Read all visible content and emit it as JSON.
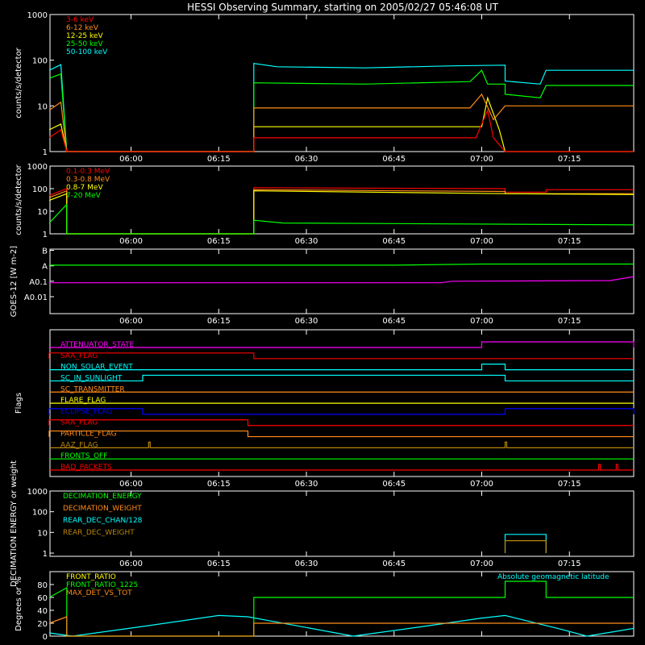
{
  "title": "HESSI Observing Summary, starting on 2005/02/27 05:46:08 UT",
  "time_ticks": [
    "06:00",
    "06:15",
    "06:30",
    "06:45",
    "07:00",
    "07:15"
  ],
  "colors": {
    "red": "#ff0000",
    "orange": "#ff8c1a",
    "yellow": "#ffff00",
    "green": "#00ff00",
    "cyan": "#00ffff",
    "blue": "#0000ff",
    "magenta": "#ff00ff",
    "brown": "#b8860b",
    "white": "#ffffff",
    "axis": "#ffffff"
  },
  "chart_data": [
    {
      "id": "panel1",
      "type": "line",
      "yscale": "log",
      "ylabel": "counts/s/detector",
      "ylim": [
        1,
        1000
      ],
      "yticks": [
        1,
        10,
        100,
        1000
      ],
      "ytick_labels": [
        "1",
        "10",
        "100",
        "1000"
      ],
      "time_window": [
        "05:46:08",
        "07:26:00"
      ],
      "legend": [
        "3-6 keV",
        "6-12 keV",
        "12-25 keV",
        "25-50 keV",
        "50-100 keV"
      ],
      "series": [
        {
          "name": "50-100 keV",
          "color": "cyan",
          "points": [
            [
              "05:46",
              "60"
            ],
            [
              "05:48",
              "80"
            ],
            [
              "05:49",
              "1"
            ],
            [
              "06:21",
              "1"
            ],
            [
              "06:21",
              "85"
            ],
            [
              "06:25",
              "72"
            ],
            [
              "06:40",
              "68"
            ],
            [
              "06:55",
              "75"
            ],
            [
              "07:04",
              "78"
            ],
            [
              "07:04",
              "35"
            ],
            [
              "07:10",
              "30"
            ],
            [
              "07:11",
              "60"
            ],
            [
              "07:26",
              "60"
            ]
          ]
        },
        {
          "name": "25-50 keV",
          "color": "green",
          "points": [
            [
              "05:46",
              "40"
            ],
            [
              "05:48",
              "50"
            ],
            [
              "05:49",
              "1"
            ],
            [
              "06:21",
              "1"
            ],
            [
              "06:21",
              "32"
            ],
            [
              "06:40",
              "30"
            ],
            [
              "06:58",
              "34"
            ],
            [
              "07:00",
              "60"
            ],
            [
              "07:01",
              "30"
            ],
            [
              "07:04",
              "30"
            ],
            [
              "07:04",
              "18"
            ],
            [
              "07:10",
              "15"
            ],
            [
              "07:11",
              "28"
            ],
            [
              "07:26",
              "28"
            ]
          ]
        },
        {
          "name": "12-25 keV",
          "color": "yellow",
          "points": [
            [
              "05:46",
              "3"
            ],
            [
              "05:48",
              "4"
            ],
            [
              "05:49",
              "1"
            ],
            [
              "06:21",
              "1"
            ],
            [
              "06:21",
              "3.5"
            ],
            [
              "07:00",
              "3.5"
            ],
            [
              "07:01",
              "15"
            ],
            [
              "07:03",
              "3"
            ],
            [
              "07:04",
              "1"
            ],
            [
              "07:26",
              "1"
            ]
          ]
        },
        {
          "name": "6-12 keV",
          "color": "orange",
          "points": [
            [
              "05:46",
              "8"
            ],
            [
              "05:48",
              "12"
            ],
            [
              "05:49",
              "1"
            ],
            [
              "06:21",
              "1"
            ],
            [
              "06:21",
              "9"
            ],
            [
              "06:58",
              "9"
            ],
            [
              "07:00",
              "18"
            ],
            [
              "07:02",
              "5"
            ],
            [
              "07:04",
              "10"
            ],
            [
              "07:26",
              "10"
            ]
          ]
        },
        {
          "name": "3-6 keV",
          "color": "red",
          "points": [
            [
              "05:46",
              "2"
            ],
            [
              "05:48",
              "3"
            ],
            [
              "05:49",
              "1"
            ],
            [
              "06:21",
              "1"
            ],
            [
              "06:21",
              "2"
            ],
            [
              "06:59",
              "2"
            ],
            [
              "07:01",
              "8"
            ],
            [
              "07:02",
              "2"
            ],
            [
              "07:04",
              "1"
            ],
            [
              "07:26",
              "1"
            ]
          ]
        }
      ]
    },
    {
      "id": "panel2",
      "type": "line",
      "yscale": "log",
      "ylabel": "counts/s/detector",
      "ylim": [
        1,
        1000
      ],
      "yticks": [
        1,
        10,
        100,
        1000
      ],
      "ytick_labels": [
        "1",
        "10",
        "100",
        "1000"
      ],
      "time_window": [
        "05:46:08",
        "07:26:00"
      ],
      "legend": [
        "0.1-0.3 MeV",
        "0.3-0.8 MeV",
        "0.8-7 MeV",
        "7-20 MeV"
      ],
      "series": [
        {
          "name": "0.1-0.3 MeV",
          "color": "red",
          "points": [
            [
              "05:46",
              "50"
            ],
            [
              "05:49",
              "100"
            ],
            [
              "05:49",
              "1"
            ],
            [
              "06:21",
              "1"
            ],
            [
              "06:21",
              "110"
            ],
            [
              "07:04",
              "100"
            ],
            [
              "07:04",
              "70"
            ],
            [
              "07:11",
              "70"
            ],
            [
              "07:11",
              "90"
            ],
            [
              "07:26",
              "90"
            ]
          ]
        },
        {
          "name": "0.3-0.8 MeV",
          "color": "orange",
          "points": [
            [
              "05:46",
              "40"
            ],
            [
              "05:49",
              "80"
            ],
            [
              "05:49",
              "1"
            ],
            [
              "06:21",
              "1"
            ],
            [
              "06:21",
              "90"
            ],
            [
              "07:04",
              "75"
            ],
            [
              "07:04",
              "60"
            ],
            [
              "07:26",
              "60"
            ]
          ]
        },
        {
          "name": "0.8-7 MeV",
          "color": "yellow",
          "points": [
            [
              "05:46",
              "30"
            ],
            [
              "05:49",
              "60"
            ],
            [
              "05:49",
              "1"
            ],
            [
              "06:21",
              "1"
            ],
            [
              "06:21",
              "80"
            ],
            [
              "07:04",
              "60"
            ],
            [
              "07:26",
              "55"
            ]
          ]
        },
        {
          "name": "7-20 MeV",
          "color": "green",
          "points": [
            [
              "05:46",
              "3"
            ],
            [
              "05:49",
              "20"
            ],
            [
              "05:49",
              "1"
            ],
            [
              "06:21",
              "1"
            ],
            [
              "06:21",
              "4"
            ],
            [
              "06:26",
              "3"
            ],
            [
              "07:26",
              "2.5"
            ]
          ]
        }
      ]
    },
    {
      "id": "panel3",
      "type": "line",
      "yscale": "log",
      "ylabel": "GOES-12 [W m-2]",
      "ylim": [
        0.0008,
        12
      ],
      "yticks": [
        0.01,
        0.1,
        1,
        10
      ],
      "ytick_labels": [
        "A0.01",
        "A0.1",
        "A",
        "B"
      ],
      "time_window": [
        "05:46:08",
        "07:26:00"
      ],
      "series": [
        {
          "name": "",
          "color": "green",
          "points": [
            [
              "05:46",
              "1.1"
            ],
            [
              "06:45",
              "1.1"
            ],
            [
              "07:00",
              "1.3"
            ],
            [
              "07:26",
              "1.3"
            ]
          ]
        },
        {
          "name": "",
          "color": "magenta",
          "points": [
            [
              "05:46",
              "0.08"
            ],
            [
              "06:53",
              "0.08"
            ],
            [
              "06:55",
              "0.1"
            ],
            [
              "07:22",
              "0.11"
            ],
            [
              "07:26",
              "0.2"
            ]
          ]
        }
      ]
    },
    {
      "id": "flags",
      "type": "flags",
      "ylabel": "Flags",
      "time_window": [
        "05:46:08",
        "07:26:00"
      ],
      "rows": [
        {
          "name": "ATTENUATOR_STATE",
          "color": "magenta",
          "on": [
            [
              "07:00",
              "07:26"
            ]
          ]
        },
        {
          "name": "SAA_FLAG",
          "color": "red",
          "on": [
            [
              "05:46",
              "06:21"
            ]
          ]
        },
        {
          "name": "NON_SOLAR_EVENT",
          "color": "cyan",
          "on": [
            [
              "07:00",
              "07:04"
            ]
          ]
        },
        {
          "name": "SC_IN_SUNLIGHT",
          "color": "cyan",
          "on": [
            [
              "06:02",
              "07:04"
            ]
          ]
        },
        {
          "name": "SC_TRANSMITTER",
          "color": "orange",
          "on": []
        },
        {
          "name": "FLARE_FLAG",
          "color": "yellow",
          "on": []
        },
        {
          "name": "ECLIPSE_FLAG",
          "color": "blue",
          "on": [
            [
              "05:46",
              "06:02"
            ],
            [
              "07:04",
              "07:26"
            ]
          ]
        },
        {
          "name": "SAA_FLAG",
          "color": "red",
          "on": [
            [
              "05:46",
              "06:20"
            ]
          ]
        },
        {
          "name": "PARTICLE_FLAG",
          "color": "orange",
          "on": [
            [
              "05:46",
              "06:20"
            ]
          ]
        },
        {
          "name": "AAZ_FLAG",
          "color": "brown",
          "on": [
            [
              "06:03",
              "06:03"
            ],
            [
              "07:04",
              "07:04"
            ]
          ]
        },
        {
          "name": "FRONTS_OFF",
          "color": "green",
          "on": []
        },
        {
          "name": "BAD_PACKETS",
          "color": "red",
          "on": [
            [
              "07:20",
              "07:20"
            ],
            [
              "07:23",
              "07:23"
            ]
          ]
        }
      ]
    },
    {
      "id": "decimation",
      "type": "line",
      "yscale": "log",
      "ylabel": "DECIMATION ENERGY or weight",
      "ylim": [
        0.7,
        1000
      ],
      "yticks": [
        1,
        10,
        100,
        1000
      ],
      "ytick_labels": [
        "1",
        "10",
        "100",
        "1000"
      ],
      "time_window": [
        "05:46:08",
        "07:26:00"
      ],
      "legend": [
        "DECIMATION_ENERGY",
        "DECIMATION_WEIGHT",
        "REAR_DEC_CHAN/128",
        "REAR_DEC_WEIGHT"
      ],
      "series": [
        {
          "name": "REAR_DEC_CHAN/128",
          "color": "cyan",
          "points": [
            [
              "07:04",
              "1"
            ],
            [
              "07:04",
              "8"
            ],
            [
              "07:11",
              "8"
            ],
            [
              "07:11",
              "1"
            ]
          ]
        },
        {
          "name": "REAR_DEC_WEIGHT",
          "color": "brown",
          "points": [
            [
              "07:04",
              "1"
            ],
            [
              "07:04",
              "4"
            ],
            [
              "07:11",
              "4"
            ],
            [
              "07:11",
              "1"
            ]
          ]
        }
      ]
    },
    {
      "id": "bottom",
      "type": "line",
      "yscale": "linear",
      "ylabel": "Degrees or %",
      "ylim": [
        0,
        100
      ],
      "yticks": [
        0,
        20,
        40,
        60,
        80
      ],
      "ytick_labels": [
        "0",
        "20",
        "40",
        "60",
        "80"
      ],
      "time_window": [
        "05:46:08",
        "07:26:00"
      ],
      "legend": [
        "FRONT_RATIO",
        "FRONT_RATIO_1225",
        "MAX_DET_VS_TOT"
      ],
      "annotation": "Absolute geomagnetic latitude",
      "series": [
        {
          "name": "Absolute geomagnetic latitude",
          "color": "cyan",
          "points": [
            [
              "05:46",
              "5"
            ],
            [
              "05:50",
              "0"
            ],
            [
              "06:02",
              "15"
            ],
            [
              "06:15",
              "32"
            ],
            [
              "06:20",
              "30"
            ],
            [
              "06:35",
              "5"
            ],
            [
              "06:38",
              "0"
            ],
            [
              "06:50",
              "15"
            ],
            [
              "07:00",
              "28"
            ],
            [
              "07:04",
              "32"
            ],
            [
              "07:13",
              "12"
            ],
            [
              "07:18",
              "0"
            ],
            [
              "07:26",
              "12"
            ]
          ]
        },
        {
          "name": "FRONT_RATIO_1225",
          "color": "green",
          "points": [
            [
              "05:46",
              "60"
            ],
            [
              "05:49",
              "75"
            ],
            [
              "05:49",
              "0"
            ],
            [
              "06:21",
              "0"
            ],
            [
              "06:21",
              "60"
            ],
            [
              "07:04",
              "60"
            ],
            [
              "07:04",
              "85"
            ],
            [
              "07:11",
              "85"
            ],
            [
              "07:11",
              "60"
            ],
            [
              "07:26",
              "60"
            ]
          ]
        },
        {
          "name": "MAX_DET_VS_TOT",
          "color": "orange",
          "points": [
            [
              "05:46",
              "20"
            ],
            [
              "05:49",
              "30"
            ],
            [
              "05:49",
              "0"
            ],
            [
              "06:21",
              "0"
            ],
            [
              "06:21",
              "20"
            ],
            [
              "07:26",
              "20"
            ]
          ]
        }
      ]
    }
  ]
}
